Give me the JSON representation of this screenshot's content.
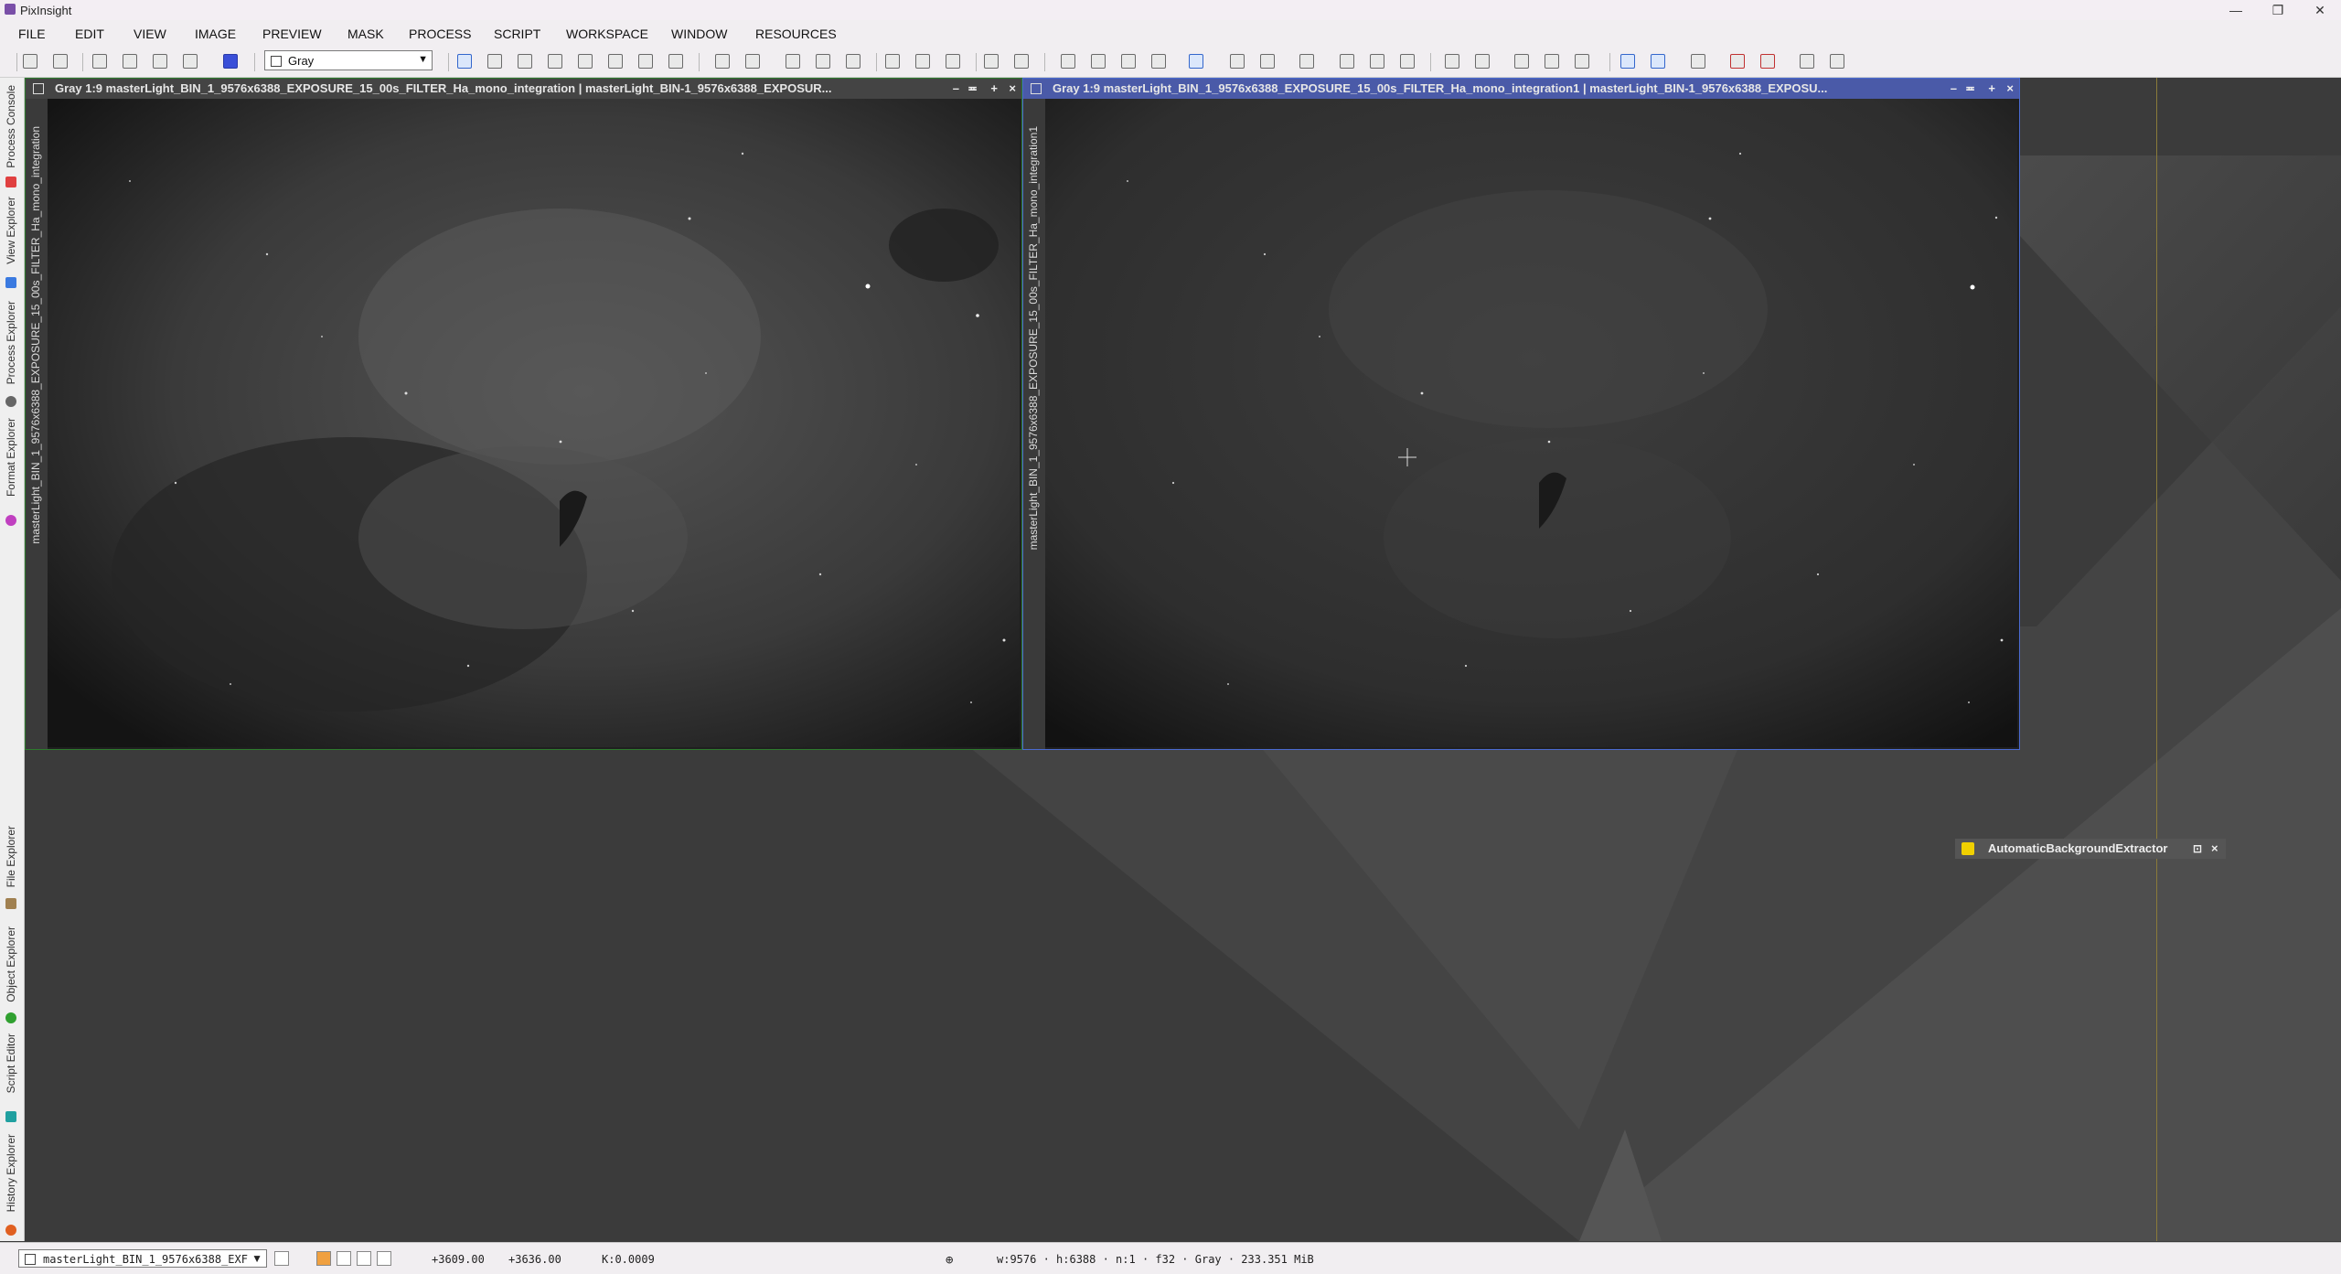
{
  "app": {
    "title": "PixInsight"
  },
  "window_controls": {
    "minimize": "—",
    "restore": "❐",
    "close": "✕"
  },
  "menu": [
    "FILE",
    "EDIT",
    "VIEW",
    "IMAGE",
    "PREVIEW",
    "MASK",
    "PROCESS",
    "SCRIPT",
    "WORKSPACE",
    "WINDOW",
    "RESOURCES"
  ],
  "toolbar": {
    "view_mode": "Gray"
  },
  "side_dock": {
    "top_tabs": [
      "Process Console",
      "View Explorer",
      "Process Explorer",
      "Format Explorer"
    ],
    "bottom_tabs": [
      "File Explorer",
      "Object Explorer",
      "Script Editor",
      "History Explorer"
    ],
    "colors": {
      "process_console": "#e04040",
      "view_explorer": "#3a7ae0",
      "process_explorer": "#666666",
      "format_explorer": "#c040c0",
      "file_explorer": "#a08050",
      "object_explorer": "#30a030",
      "script_editor": "#20a0a0",
      "history_explorer": "#e06020"
    }
  },
  "image_windows": [
    {
      "title": "Gray 1:9 masterLight_BIN_1_9576x6388_EXPOSURE_15_00s_FILTER_Ha_mono_integration | masterLight_BIN-1_9576x6388_EXPOSUR...",
      "side_label": "masterLight_BIN_1_9576x6388_EXPOSURE_15_00s_FILTER_Ha_mono_integration",
      "active": false
    },
    {
      "title": "Gray 1:9 masterLight_BIN_1_9576x6388_EXPOSURE_15_00s_FILTER_Ha_mono_integration1 | masterLight_BIN-1_9576x6388_EXPOSU...",
      "side_label": "masterLight_BIN_1_9576x6388_EXPOSURE_15_00s_FILTER_Ha_mono_integration1",
      "active": true
    }
  ],
  "window_buttons": {
    "minimize": "–",
    "shade": "≖",
    "maximize": "+",
    "close": "×"
  },
  "process_panel": {
    "title": "AutomaticBackgroundExtractor"
  },
  "status": {
    "view_selector": "masterLight_BIN_1_9576x6388_EXF",
    "x": "+3609.00",
    "y": "+3636.00",
    "k": "K:0.0009",
    "info": "w:9576 · h:6388 · n:1 · f32 · Gray · 233.351 MiB"
  }
}
